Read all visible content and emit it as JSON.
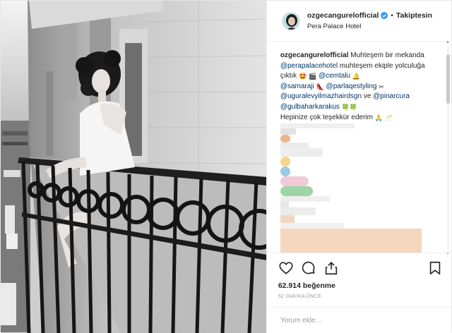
{
  "header": {
    "username": "ozgecangurelofficial",
    "separator": "•",
    "follow_label": "Takiptesin",
    "location": "Pera Palace Hotel"
  },
  "caption": {
    "username": "ozgecangurelofficial",
    "t1": "Muhteşem bir mekanda",
    "m1": "@perapalacehotel",
    "t2": "muhteşem ekiple yolculuğa çıktık",
    "m2": "@cemtalu",
    "m3": "@samaraji",
    "m4": "@parlaqestyling",
    "m5": "@uguralevyilmazhairdsgn",
    "t3": "ve",
    "m6": "@pinarcura",
    "m7": "@gulbaharkarakus",
    "t4": "Hepinize çok teşekkür ederim"
  },
  "actions": {
    "likes": "62.914 beğenme",
    "time": "52 DAKİKA ÖNCE"
  },
  "comment": {
    "placeholder": "Yorum ekle..."
  },
  "icons": {
    "verified": "verified-badge-icon",
    "like": "heart-icon",
    "comment": "comment-bubble-icon",
    "share": "share-icon",
    "save": "bookmark-icon"
  },
  "colors": {
    "mention": "#003569",
    "verified": "#3897f0",
    "muted": "#999999",
    "text": "#262626"
  }
}
